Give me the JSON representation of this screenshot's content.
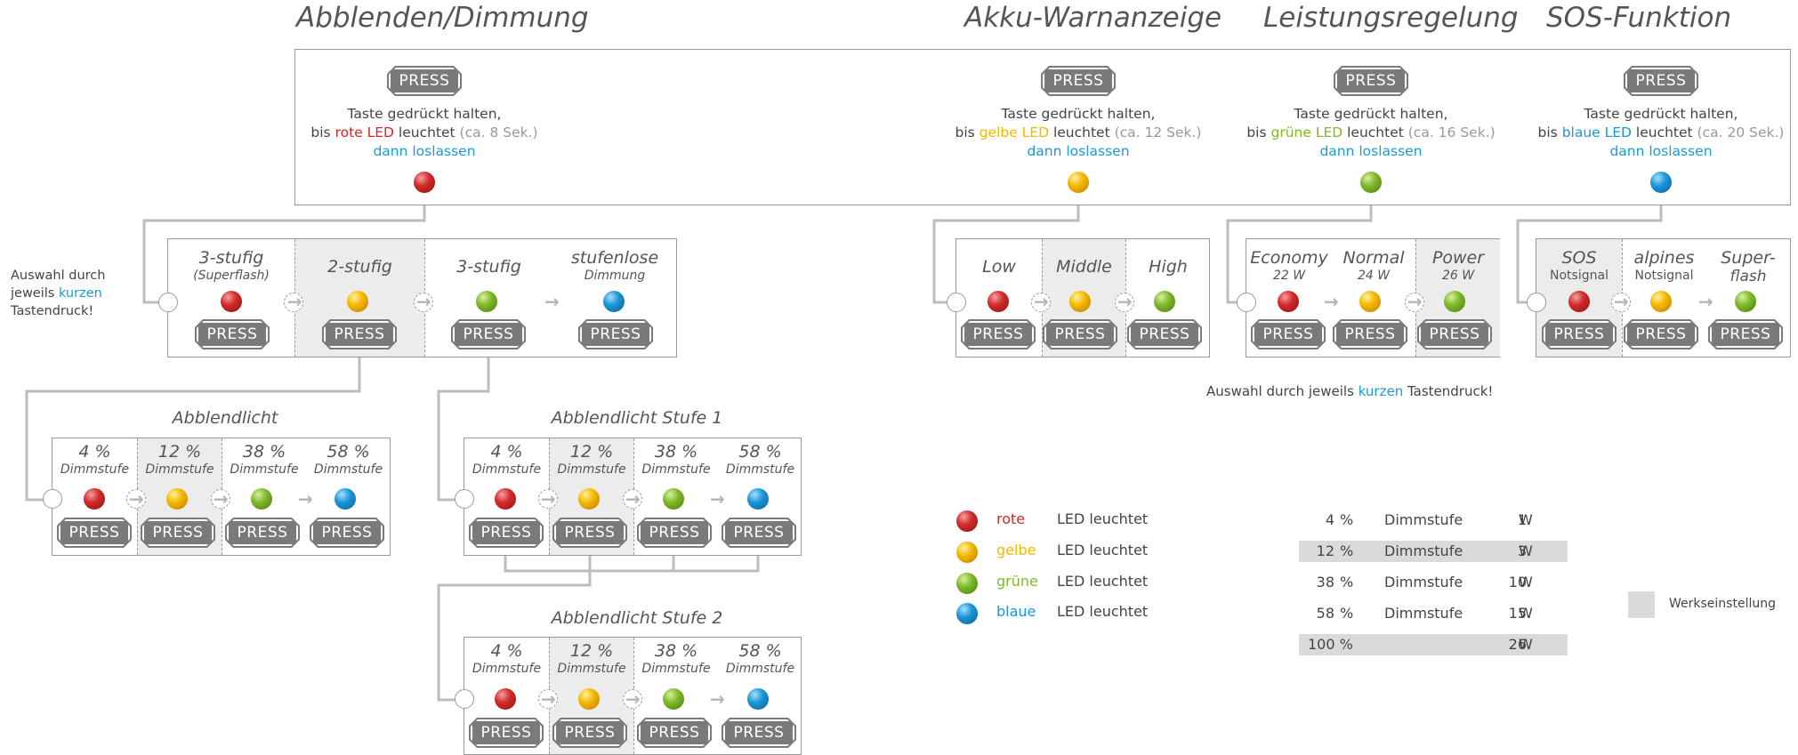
{
  "sections": {
    "dimming": {
      "title": "Abblenden/Dimmung",
      "line1": "Taste gedrückt halten,",
      "line2_pre": "bis ",
      "line2_color": "rote LED",
      "line2_post": " leuchtet ",
      "line2_time": "(ca. 8 Sek.)",
      "line3": "dann loslassen",
      "color": "#d22a2a"
    },
    "battery": {
      "title": "Akku-Warnanzeige",
      "line1": "Taste gedrückt halten,",
      "line2_pre": "bis ",
      "line2_color": "gelbe LED",
      "line2_post": " leuchtet ",
      "line2_time": "(ca. 12 Sek.)",
      "line3": "dann loslassen",
      "color": "#f4b800"
    },
    "power": {
      "title": "Leistungsregelung",
      "line1": "Taste gedrückt halten,",
      "line2_pre": "bis ",
      "line2_color": "grüne LED",
      "line2_post": " leuchtet ",
      "line2_time": "(ca. 16 Sek.)",
      "line3": "dann loslassen",
      "color": "#80b82a"
    },
    "sos": {
      "title": "SOS-Funktion",
      "line1": "Taste gedrückt halten,",
      "line2_pre": "bis ",
      "line2_color": "blaue LED",
      "line2_post": " leuchtet ",
      "line2_time": "(ca. 20 Sek.)",
      "line3": "dann loslassen",
      "color": "#1b95d8"
    }
  },
  "press_label": "PRESS",
  "dim_modes": [
    {
      "label": "3-stufig",
      "sub": "(Superflash)"
    },
    {
      "label": "2-stufig",
      "sub": ""
    },
    {
      "label": "3-stufig",
      "sub": ""
    },
    {
      "label": "stufenlose",
      "sub": "Dimmung"
    }
  ],
  "battery_modes": [
    {
      "label": "Low"
    },
    {
      "label": "Middle"
    },
    {
      "label": "High"
    }
  ],
  "power_modes": [
    {
      "label": "Economy",
      "sub": "22 W"
    },
    {
      "label": "Normal",
      "sub": "24 W"
    },
    {
      "label": "Power",
      "sub": "26 W"
    }
  ],
  "sos_modes": [
    {
      "label": "SOS",
      "sub": "Notsignal"
    },
    {
      "label": "alpines",
      "sub": "Notsignal"
    },
    {
      "label": "Super-",
      "sub": "flash"
    }
  ],
  "side_note": {
    "pre": "Auswahl durch",
    "mid_pre": "jeweils ",
    "mid_blue": "kurzen",
    "post": "Tastendruck!"
  },
  "bottom_note": {
    "pre": "Auswahl durch jeweils ",
    "blue": "kurzen",
    "post": " Tastendruck!"
  },
  "dim_levels": [
    {
      "pct": "4 %",
      "sub": "Dimmstufe"
    },
    {
      "pct": "12 %",
      "sub": "Dimmstufe"
    },
    {
      "pct": "38 %",
      "sub": "Dimmstufe"
    },
    {
      "pct": "58 %",
      "sub": "Dimmstufe"
    }
  ],
  "sub_tables": {
    "abblendlicht": "Abblendlicht",
    "stufe1": "Abblendlicht Stufe 1",
    "stufe2": "Abblendlicht Stufe 2"
  },
  "legend": [
    {
      "color_word": "rote",
      "text": "LED leuchtet",
      "color": "#d22a2a"
    },
    {
      "color_word": "gelbe",
      "text": "LED leuchtet",
      "color": "#f4b800"
    },
    {
      "color_word": "grüne",
      "text": "LED leuchtet",
      "color": "#80b82a"
    },
    {
      "color_word": "blaue",
      "text": "LED leuchtet",
      "color": "#1b95d8"
    }
  ],
  "power_table": [
    {
      "pct": "4",
      "unit": "%",
      "label": "Dimmstufe",
      "w": "1",
      "wunit": "W",
      "hl": false
    },
    {
      "pct": "12",
      "unit": "%",
      "label": "Dimmstufe",
      "w": "3",
      "wunit": "W",
      "hl": true
    },
    {
      "pct": "38",
      "unit": "%",
      "label": "Dimmstufe",
      "w": "10",
      "wunit": "W",
      "hl": false
    },
    {
      "pct": "58",
      "unit": "%",
      "label": "Dimmstufe",
      "w": "15",
      "wunit": "W",
      "hl": false
    },
    {
      "pct": "100 %",
      "unit": "",
      "label": "",
      "w": "26",
      "wunit": "W",
      "hl": true
    }
  ],
  "factory_note": "Werkseinstellung"
}
